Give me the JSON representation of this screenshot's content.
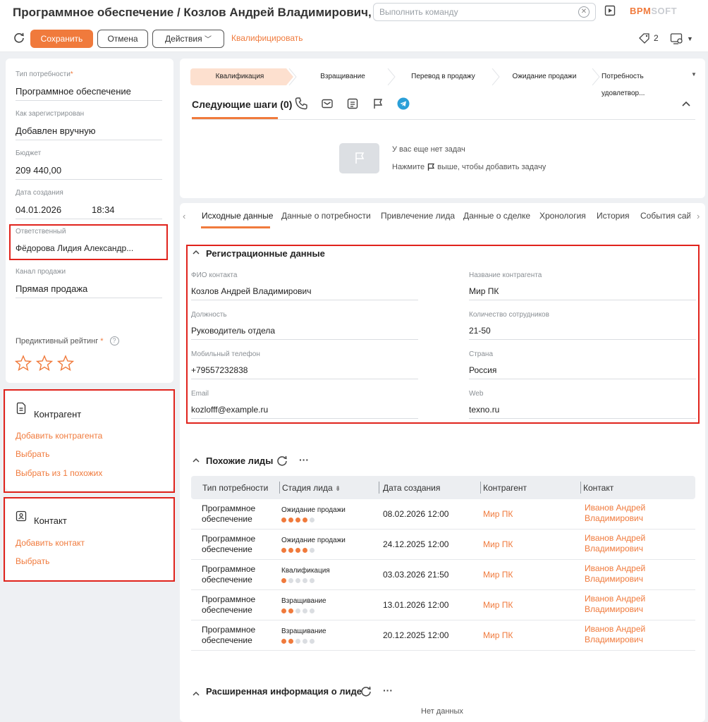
{
  "header": {
    "title": "Программное обеспечение / Козлов Андрей Владимирович, Мир ПК",
    "command_placeholder": "Выполнить команду",
    "logo_a": "BPM",
    "logo_b": "SOFT"
  },
  "toolbar": {
    "save": "Сохранить",
    "cancel": "Отмена",
    "actions": "Действия",
    "qualify": "Квалифицировать",
    "tag_count": "2"
  },
  "colors": {
    "accent": "#f07a3c",
    "highlight": "#e0231c",
    "telegram": "#2a9fd8"
  },
  "left": {
    "fields": [
      {
        "label": "Тип потребности",
        "value": "Программное обеспечение",
        "required": "*"
      },
      {
        "label": "Как зарегистрирован",
        "value": "Добавлен вручную"
      },
      {
        "label": "Бюджет",
        "value": "209 440,00"
      },
      {
        "label": "Дата создания",
        "value": "04.01.2026",
        "time": "18:34"
      },
      {
        "label": "Ответственный",
        "value": "Фёдорова Лидия Александр..."
      },
      {
        "label": "Канал продажи",
        "value": "Прямая продажа"
      }
    ],
    "rating_label": "Предиктивный рейтинг",
    "rating_required": "*",
    "rating_help": "?",
    "rating_stars": 0,
    "account": {
      "title": "Контрагент",
      "links": [
        "Добавить контрагента",
        "Выбрать",
        "Выбрать из 1 похожих"
      ]
    },
    "contact": {
      "title": "Контакт",
      "links": [
        "Добавить контакт",
        "Выбрать"
      ]
    }
  },
  "stages": [
    "Квалификация",
    "Взращивание",
    "Перевод в продажу",
    "Ожидание продажи",
    "Потребность удовлетвор..."
  ],
  "active_stage": 0,
  "next_steps": {
    "title": "Следующие шаги (0)",
    "empty_line1": "У вас еще нет задач",
    "empty_line2a": "Нажмите",
    "empty_line2b": "выше, чтобы добавить задачу"
  },
  "tabs": [
    "Исходные данные",
    "Данные о потребности",
    "Привлечение лида",
    "Данные о сделке",
    "Хронология",
    "История",
    "События сай"
  ],
  "registration": {
    "title": "Регистрационные данные",
    "left": [
      {
        "label": "ФИО контакта",
        "value": "Козлов Андрей Владимирович"
      },
      {
        "label": "Должность",
        "value": "Руководитель отдела"
      },
      {
        "label": "Мобильный телефон",
        "value": "+79557232838"
      },
      {
        "label": "Email",
        "value": "kozlofff@example.ru"
      }
    ],
    "right": [
      {
        "label": "Название контрагента",
        "value": "Мир ПК"
      },
      {
        "label": "Количество сотрудников",
        "value": "21-50"
      },
      {
        "label": "Страна",
        "value": "Россия"
      },
      {
        "label": "Web",
        "value": "texno.ru"
      }
    ]
  },
  "similar": {
    "title": "Похожие лиды",
    "columns": [
      "Тип потребности",
      "Стадия лида",
      "Дата создания",
      "Контрагент",
      "Контакт"
    ],
    "rows": [
      {
        "type1": "Программное",
        "type2": "обеспечение",
        "stage": "Ожидание продажи",
        "progress": 4,
        "date": "08.02.2026 12:00",
        "account": "Мир ПК",
        "contact1": "Иванов Андрей",
        "contact2": "Владимирович"
      },
      {
        "type1": "Программное",
        "type2": "обеспечение",
        "stage": "Ожидание продажи",
        "progress": 4,
        "date": "24.12.2025 12:00",
        "account": "Мир ПК",
        "contact1": "Иванов Андрей",
        "contact2": "Владимирович"
      },
      {
        "type1": "Программное",
        "type2": "обеспечение",
        "stage": "Квалификация",
        "progress": 1,
        "date": "03.03.2026 21:50",
        "account": "Мир ПК",
        "contact1": "Иванов Андрей",
        "contact2": "Владимирович"
      },
      {
        "type1": "Программное",
        "type2": "обеспечение",
        "stage": "Взращивание",
        "progress": 2,
        "date": "13.01.2026 12:00",
        "account": "Мир ПК",
        "contact1": "Иванов Андрей",
        "contact2": "Владимирович"
      },
      {
        "type1": "Программное",
        "type2": "обеспечение",
        "stage": "Взращивание",
        "progress": 2,
        "date": "20.12.2025 12:00",
        "account": "Мир ПК",
        "contact1": "Иванов Андрей",
        "contact2": "Владимирович"
      }
    ]
  },
  "extended": {
    "title": "Расширенная информация о лиде",
    "empty": "Нет данных"
  }
}
